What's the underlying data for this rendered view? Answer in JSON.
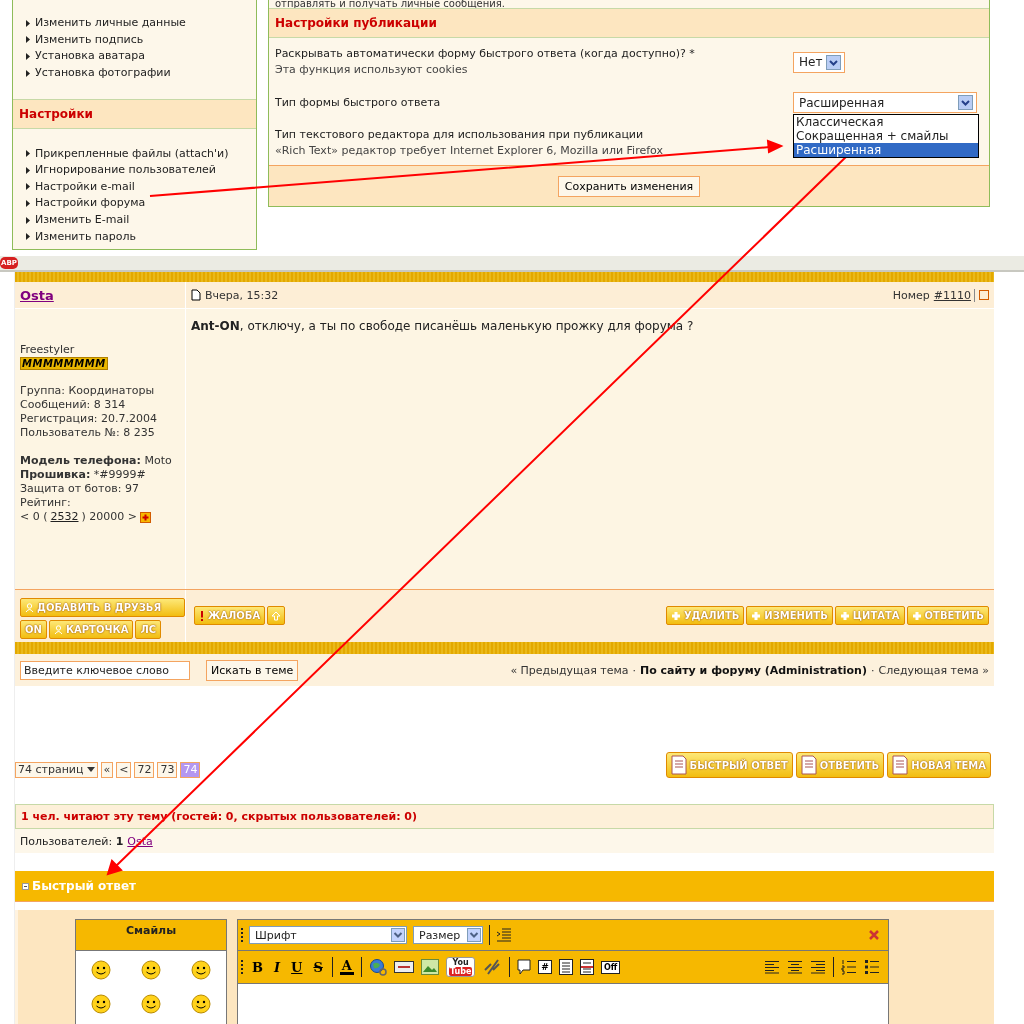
{
  "sidebar": {
    "top_items": [
      "Изменить личные данные",
      "Изменить подпись",
      "Установка аватара",
      "Установка фотографии"
    ],
    "section": {
      "title": "Настройки",
      "items": [
        "Прикрепленные файлы (attach'и)",
        "Игнорирование пользователей",
        "Настройки e-mail",
        "Настройки форума",
        "Изменить E-mail",
        "Изменить пароль"
      ]
    }
  },
  "settings_panel": {
    "cut_line": "отправлять и получать личные сообщения.",
    "title": "Настройки публикации",
    "rows": [
      {
        "label": "Раскрывать автоматически форму быстрого ответа (когда доступно)? *",
        "hint": "Эта функция используют cookies",
        "select": "Нет"
      },
      {
        "label": "Тип формы быстрого ответа",
        "select": "Расширенная",
        "expanded": true
      },
      {
        "label": "Тип текстового редактора для использования при публикации",
        "hint": "«Rich Text» редактор требует Internet Explorer 6, Mozilla или Firefox"
      }
    ],
    "dropdown_options": [
      {
        "label": "Классическая",
        "selected": false
      },
      {
        "label": "Сокращенная + смайлы",
        "selected": false
      },
      {
        "label": "Расширенная",
        "selected": true
      }
    ],
    "save_button": "Сохранить изменения"
  },
  "browser_bar": {
    "badge": "ABP"
  },
  "post": {
    "author": "Osta",
    "date": "Вчера, 15:32",
    "number_label": "Номер",
    "number_link": "#1110",
    "select_checked": false,
    "text": "**Ant-ON**, отключу, а ты по свободе писанёшь маленькую прожку для форума ?",
    "user_title": "Freestyler",
    "rank": "MMMMMMMM",
    "stats": [
      "Группа: Координаторы",
      "Сообщений: 8 314",
      "Регистрация: 20.7.2004",
      "Пользователь №: 8 235"
    ],
    "fields": [
      "**Модель телефона:** Moto",
      "**Прошивка:** *#9999#",
      "Защита от ботов: 97"
    ],
    "rating": {
      "label": "Рейтинг:",
      "before": "< 0 (",
      "link": "2532",
      "after": ") 20000 >"
    },
    "user_buttons": [
      "ДОБАВИТЬ В ДРУЗЬЯ",
      "ON",
      "КАРТОЧКА",
      "ЛС"
    ],
    "report_button": "ЖАЛОБА",
    "action_buttons": [
      "УДАЛИТЬ",
      "ИЗМЕНИТЬ",
      "ЦИТАТА",
      "ОТВЕТИТЬ"
    ]
  },
  "search": {
    "placeholder": "Введите ключевое слово",
    "button": "Искать в теме"
  },
  "topic_nav": {
    "prev": "« Предыдущая тема",
    "forum": "По сайту и форуму (Administration)",
    "next": "Следующая тема »",
    "separator": "·"
  },
  "pagination": {
    "count": "74 страниц",
    "first": "«",
    "prev": "<",
    "pages": [
      {
        "label": "72",
        "selected": false
      },
      {
        "label": "73",
        "selected": false
      },
      {
        "label": "74",
        "selected": true
      }
    ]
  },
  "topic_buttons": [
    "БЫСТРЫЙ ОТВЕТ",
    "ОТВЕТИТЬ",
    "НОВАЯ ТЕМА"
  ],
  "online": {
    "title": "1 чел. читают эту тему (гостей: 0, скрытых пользователей: 0)",
    "users_label": "Пользователей: **1**",
    "user": "Osta"
  },
  "quick_reply": {
    "title": "Быстрый ответ",
    "smilies_title": "Смайлы",
    "font_select": "Шрифт",
    "size_select": "Размер",
    "letters": [
      "B",
      "I",
      "U",
      "S"
    ],
    "color_letter": "A",
    "video_logo": [
      "You",
      "Tube"
    ],
    "code_label": "#",
    "off_label": "Off"
  }
}
